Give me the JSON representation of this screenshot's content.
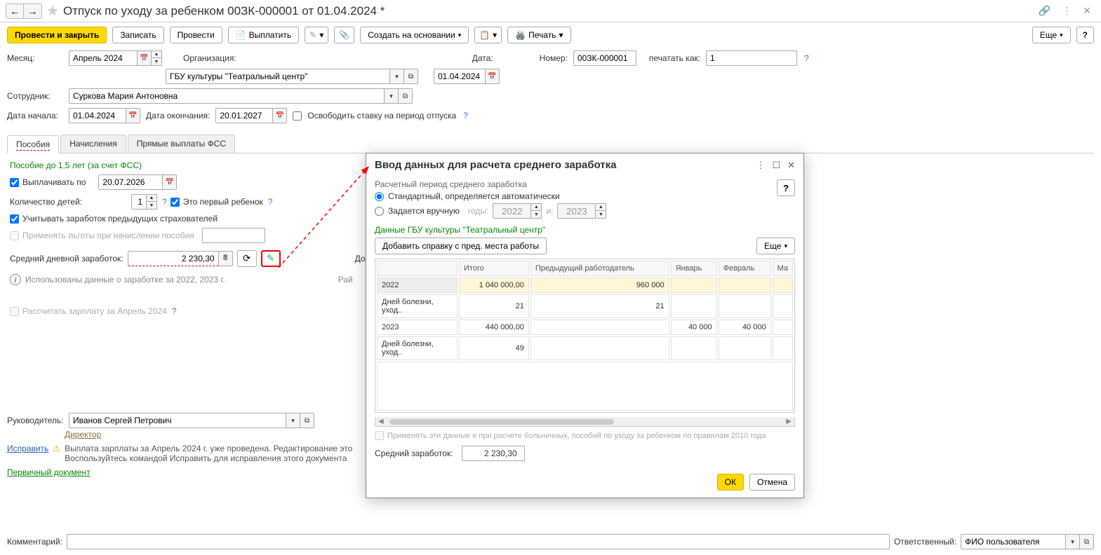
{
  "header": {
    "title": "Отпуск по уходу за ребенком 00ЗК-000001 от 01.04.2024 *"
  },
  "toolbar": {
    "submit_close": "Провести и закрыть",
    "save": "Записать",
    "submit": "Провести",
    "pay": "Выплатить",
    "create_from": "Создать на основании",
    "print": "Печать",
    "more": "Еще"
  },
  "form": {
    "month_label": "Месяц:",
    "month_value": "Апрель 2024",
    "org_label": "Организация:",
    "org_value": "ГБУ культуры \"Театральный центр\"",
    "date_label": "Дата:",
    "date_value": "01.04.2024",
    "number_label": "Номер:",
    "number_value": "00ЗК-000001",
    "print_as_label": "печатать как:",
    "print_as_value": "1",
    "employee_label": "Сотрудник:",
    "employee_value": "Суркова Мария Антоновна",
    "start_label": "Дата начала:",
    "start_value": "01.04.2024",
    "end_label": "Дата окончания:",
    "end_value": "20.01.2027",
    "free_rate": "Освободить ставку на период отпуска"
  },
  "tabs": {
    "t1": "Пособия",
    "t2": "Начисления",
    "t3": "Прямые выплаты ФСС"
  },
  "benefit": {
    "title": "Пособие до 1,5 лет (за счет ФСС)",
    "pay_until": "Выплачивать по",
    "pay_until_date": "20.07.2026",
    "children_label": "Количество детей:",
    "children_count": "1",
    "first_child": "Это первый ребенок",
    "prev_insurers": "Учитывать заработок предыдущих страхователей",
    "apply_benefits": "Применять льготы при начислении пособия",
    "avg_label": "Средний дневной заработок:",
    "avg_value": "2 230,30",
    "info_text": "Использованы данные о заработке за  2022,  2023 г.",
    "recalc": "Рассчитать зарплату за Апрель 2024",
    "dol": "Дол",
    "rai": "Рай"
  },
  "manager": {
    "label": "Руководитель:",
    "value": "Иванов Сергей Петрович",
    "position": "Директор"
  },
  "fix_link": "Исправить",
  "warning": "Выплата зарплаты за Апрель 2024 г. уже проведена. Редактирование это\nВоспользуйтесь командой Исправить для исправления этого документа",
  "primary_doc": "Первичный документ",
  "comment_label": "Комментарий:",
  "responsible_label": "Ответственный:",
  "responsible_value": "ФИО пользователя",
  "modal": {
    "title": "Ввод данных для расчета среднего заработка",
    "period_label": "Расчетный период среднего заработка",
    "radio_auto": "Стандартный, определяется автоматически",
    "radio_manual": "Задается вручную",
    "years_label": "годы:",
    "year1": "2022",
    "and": "и:",
    "year2": "2023",
    "data_label": "Данные ГБУ культуры \"Театральный центр\"",
    "add_cert": "Добавить справку с пред. места работы",
    "more": "Еще",
    "cols": {
      "total": "Итого",
      "prev": "Предыдущий работодатель",
      "jan": "Январь",
      "feb": "Февраль",
      "mar": "Ма"
    },
    "rows": [
      {
        "label": "2022",
        "total": "1 040 000,00",
        "prev": "960 000",
        "jan": "",
        "feb": ""
      },
      {
        "label": "Дней болезни, уход..",
        "total": "21",
        "prev": "21",
        "jan": "",
        "feb": ""
      },
      {
        "label": "2023",
        "total": "440 000,00",
        "prev": "",
        "jan": "40 000",
        "feb": "40 000"
      },
      {
        "label": "Дней болезни, уход..",
        "total": "49",
        "prev": "",
        "jan": "",
        "feb": ""
      }
    ],
    "apply_2010": "Применять эти данные и при расчете больничных, пособий по уходу за ребенком по правилам 2010 года",
    "avg_label": "Средний заработок:",
    "avg_value": "2 230,30",
    "ok": "ОК",
    "cancel": "Отмена"
  }
}
